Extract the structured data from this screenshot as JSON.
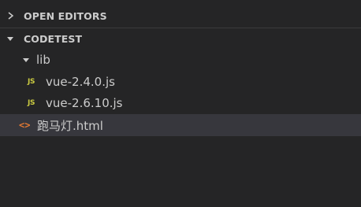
{
  "sidebar": {
    "sections": {
      "open_editors": {
        "label": "OPEN EDITORS",
        "expanded": false
      },
      "workspace": {
        "label": "CODETEST",
        "expanded": true
      }
    },
    "tree": {
      "folder": {
        "label": "lib",
        "expanded": true
      },
      "files": [
        {
          "label": "vue-2.4.0.js",
          "icon": "js-file-icon",
          "icon_text": "JS"
        },
        {
          "label": "vue-2.6.10.js",
          "icon": "js-file-icon",
          "icon_text": "JS"
        }
      ],
      "root_file": {
        "label": "跑马灯.html",
        "icon": "html-file-icon",
        "icon_text": "<>"
      }
    }
  },
  "colors": {
    "background": "#252526",
    "text": "#cccccc",
    "selected_row": "#37373d",
    "js_icon": "#cbcb41",
    "html_icon": "#e37933"
  }
}
